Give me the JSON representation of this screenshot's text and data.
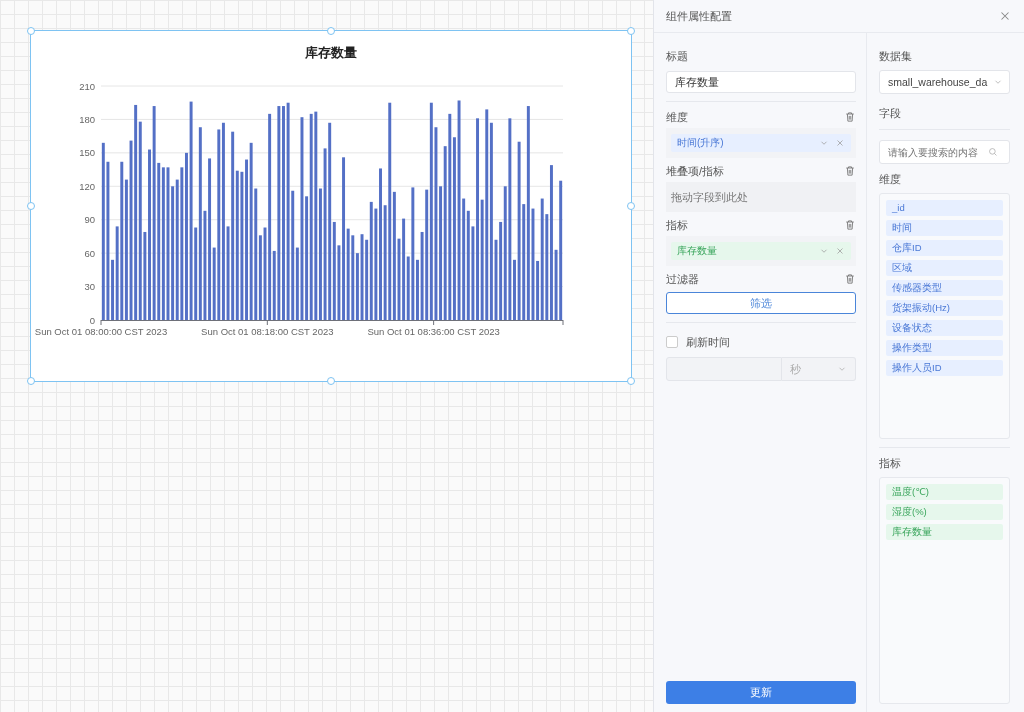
{
  "canvas": {
    "chart_card": {
      "chart_data": {
        "type": "bar",
        "title": "库存数量",
        "categories": [
          "Sun Oct 01 08:00:00 CST 2023",
          null,
          null,
          null,
          null,
          null,
          null,
          null,
          null,
          null,
          null,
          null,
          null,
          null,
          null,
          null,
          null,
          null,
          null,
          null,
          null,
          null,
          null,
          null,
          null,
          null,
          null,
          null,
          null,
          null,
          null,
          null,
          null,
          null,
          null,
          null,
          "Sun Oct 01 08:18:00 CST 2023",
          null,
          null,
          null,
          null,
          null,
          null,
          null,
          null,
          null,
          null,
          null,
          null,
          null,
          null,
          null,
          null,
          null,
          null,
          null,
          null,
          null,
          null,
          null,
          null,
          null,
          null,
          null,
          null,
          null,
          null,
          null,
          null,
          null,
          null,
          null,
          "Sun Oct 01 08:36:00 CST 2023",
          null,
          null,
          null,
          null,
          null,
          null,
          null,
          null,
          null,
          null,
          null,
          null,
          null,
          null,
          null,
          null,
          null,
          null,
          null,
          null,
          null,
          null,
          null,
          null,
          null,
          null,
          null
        ],
        "grid": true,
        "series": [
          {
            "color": "#5470c6",
            "values": [
              159,
              142,
              54,
              84,
              142,
              126,
              161,
              193,
              178,
              79,
              153,
              192,
              141,
              137,
              137,
              120,
              126,
              137,
              150,
              196,
              83,
              173,
              98,
              145,
              65,
              171,
              177,
              84,
              169,
              134,
              133,
              144,
              159,
              118,
              76,
              83,
              185,
              62,
              192,
              192,
              195,
              116,
              65,
              182,
              111,
              185,
              187,
              118,
              154,
              177,
              88,
              67,
              146,
              82,
              76,
              60,
              77,
              72,
              106,
              100,
              136,
              103,
              195,
              115,
              73,
              91,
              57,
              119,
              54,
              79,
              117,
              195,
              173,
              120,
              156,
              185,
              164,
              197,
              109,
              98,
              84,
              181,
              108,
              189,
              177,
              72,
              88,
              120,
              181,
              54,
              160,
              104,
              192,
              100,
              53,
              109,
              95,
              139,
              63,
              125
            ]
          }
        ],
        "ylim": [
          0,
          210
        ],
        "yticks": [
          0,
          30,
          60,
          90,
          120,
          150,
          180,
          210
        ]
      }
    }
  },
  "panel": {
    "title": "组件属性配置",
    "config": {
      "title_field": {
        "label": "标题",
        "value": "库存数量"
      },
      "dimension": {
        "label": "维度",
        "chips": [
          "时间(升序)"
        ]
      },
      "stack": {
        "label": "堆叠项/指标",
        "placeholder": "拖动字段到此处"
      },
      "measure": {
        "label": "指标",
        "chips": [
          "库存数量"
        ]
      },
      "filter": {
        "label": "过滤器",
        "button": "筛选"
      },
      "refresh": {
        "label": "刷新时间",
        "checked": false,
        "unit": "秒"
      },
      "update_button": "更新"
    },
    "fields": {
      "dataset_label": "数据集",
      "dataset_value": "small_warehouse_da",
      "fields_label": "字段",
      "search_placeholder": "请输入要搜索的内容",
      "dimensions": {
        "label": "维度",
        "items": [
          "_id",
          "时间",
          "仓库ID",
          "区域",
          "传感器类型",
          "货架振动(Hz)",
          "设备状态",
          "操作类型",
          "操作人员ID"
        ]
      },
      "measures": {
        "label": "指标",
        "items": [
          "温度(℃)",
          "湿度(%)",
          "库存数量"
        ]
      }
    }
  }
}
